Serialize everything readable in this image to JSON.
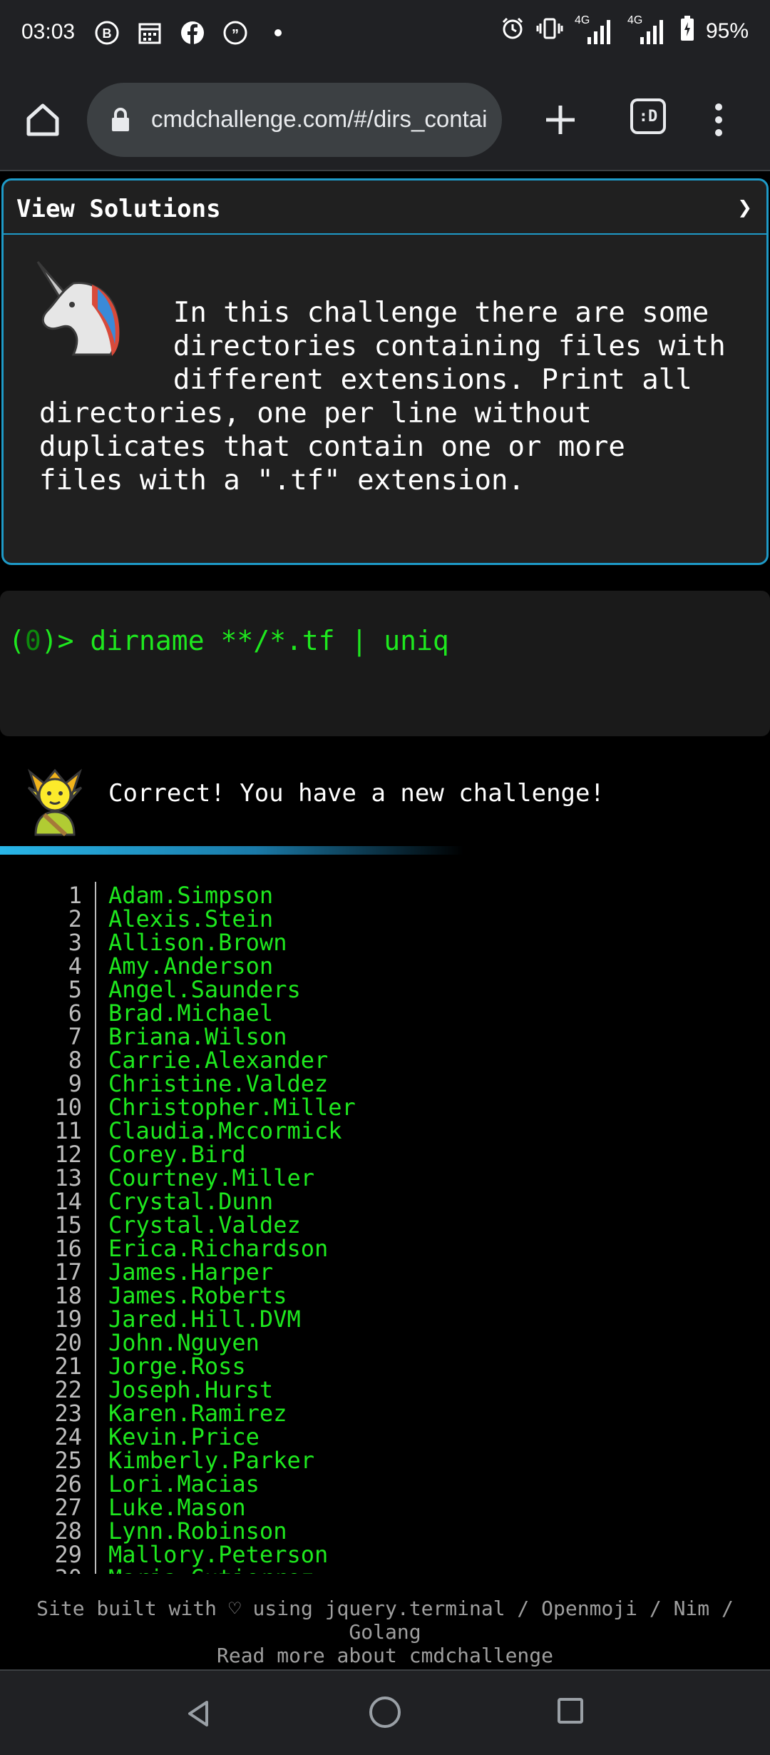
{
  "status_bar": {
    "time": "03:03",
    "battery": "95%",
    "net1": "4G",
    "net2": "4G"
  },
  "browser": {
    "url": "cmdchallenge.com/#/dirs_containing_ext",
    "tabs_label": ":D"
  },
  "solutions": {
    "title": "View Solutions",
    "arrow": "❯",
    "challenge_text": "        In this challenge there are some\n        directories containing files with\n        different extensions. Print all\ndirectories, one per line without\nduplicates that contain one or more\nfiles with a \".tf\" extension."
  },
  "terminal": {
    "prompt_prefix_open": "(",
    "prompt_code": "0",
    "prompt_prefix_close": ")> ",
    "command": "dirname **/*.tf | uniq"
  },
  "result": {
    "message": "Correct! You have a new challenge!"
  },
  "output": {
    "lines": [
      "Adam.Simpson",
      "Alexis.Stein",
      "Allison.Brown",
      "Amy.Anderson",
      "Angel.Saunders",
      "Brad.Michael",
      "Briana.Wilson",
      "Carrie.Alexander",
      "Christine.Valdez",
      "Christopher.Miller",
      "Claudia.Mccormick",
      "Corey.Bird",
      "Courtney.Miller",
      "Crystal.Dunn",
      "Crystal.Valdez",
      "Erica.Richardson",
      "James.Harper",
      "James.Roberts",
      "Jared.Hill.DVM",
      "John.Nguyen",
      "Jorge.Ross",
      "Joseph.Hurst",
      "Karen.Ramirez",
      "Kevin.Price",
      "Kimberly.Parker",
      "Lori.Macias",
      "Luke.Mason",
      "Lynn.Robinson",
      "Mallory.Peterson",
      "Maria.Gutierrez"
    ]
  },
  "footer": {
    "line1": "Site built with ♡ using jquery.terminal / Openmoji / Nim / Golang",
    "line2": "Read more about cmdchallenge"
  }
}
